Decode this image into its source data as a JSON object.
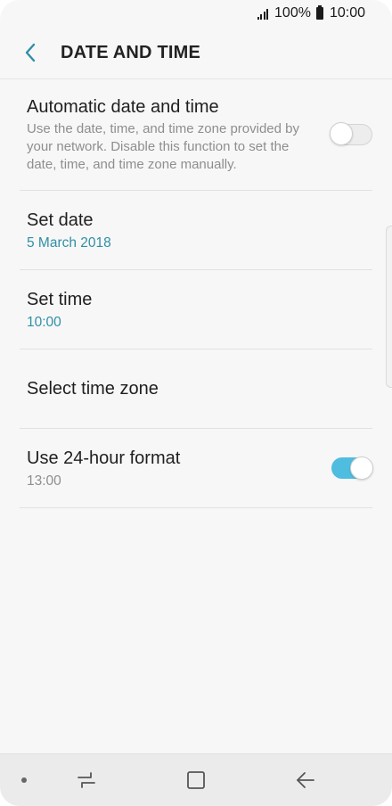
{
  "status_bar": {
    "battery": "100%",
    "time": "10:00",
    "icons": [
      "signal-icon",
      "battery-icon"
    ]
  },
  "header": {
    "title": "DATE AND TIME",
    "back_icon": "chevron-left-icon"
  },
  "settings": {
    "automatic": {
      "title": "Automatic date and time",
      "description": "Use the date, time, and time zone provided by your network. Disable this function to set the date, time, and time zone manually.",
      "enabled": false
    },
    "set_date": {
      "title": "Set date",
      "value": "5 March 2018"
    },
    "set_time": {
      "title": "Set time",
      "value": "10:00"
    },
    "time_zone": {
      "title": "Select time zone"
    },
    "format_24h": {
      "title": "Use 24-hour format",
      "value": "13:00",
      "enabled": true
    }
  },
  "nav_bar": {
    "icons": [
      "dot-icon",
      "recent-apps-icon",
      "home-icon",
      "back-arrow-icon"
    ]
  },
  "colors": {
    "accent": "#2f8fa6",
    "toggle_on": "#4fbde0",
    "background": "#f7f7f7"
  }
}
